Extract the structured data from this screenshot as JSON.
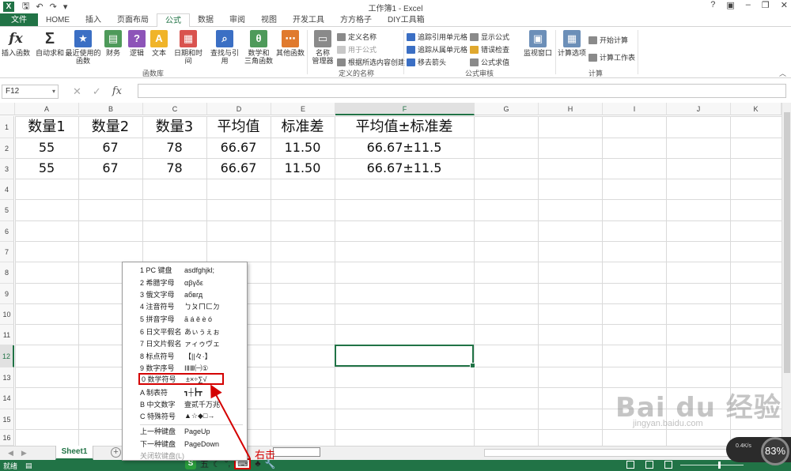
{
  "window": {
    "title": "工作簿1 - Excel",
    "help": "?",
    "min": "–",
    "restore": "❐",
    "close": "✕"
  },
  "ribbon_tabs": [
    "文件",
    "HOME",
    "插入",
    "页面布局",
    "公式",
    "数据",
    "审阅",
    "视图",
    "开发工具",
    "方方格子",
    "DIY工具箱"
  ],
  "ribbon": {
    "insert_function": "插入函数",
    "autosum": "自动求和",
    "recent": "最近使用的\n函数",
    "financial": "财务",
    "logical": "逻辑",
    "text": "文本",
    "datetime": "日期和时间",
    "lookup": "查找与引用",
    "math": "数学和\n三角函数",
    "more": "其他函数",
    "group_library": "函数库",
    "name_manager": "名称\n管理器",
    "define_name": "定义名称",
    "use_in_formula": "用于公式",
    "create_from_sel": "根据所选内容创建",
    "group_names": "定义的名称",
    "trace_prec": "追踪引用单元格",
    "trace_dep": "追踪从属单元格",
    "remove_arrows": "移去箭头",
    "show_formulas": "显示公式",
    "error_check": "错误检查",
    "eval_formula": "公式求值",
    "group_audit": "公式审核",
    "watch_window": "监视窗口",
    "calc_options": "计算选项",
    "calc_now": "开始计算",
    "calc_sheet": "计算工作表",
    "group_calc": "计算"
  },
  "formula_bar": {
    "name_box": "F12",
    "formula": ""
  },
  "columns": [
    "A",
    "B",
    "C",
    "D",
    "E",
    "F",
    "G",
    "H",
    "I",
    "J",
    "K"
  ],
  "rows": [
    "1",
    "2",
    "3",
    "4",
    "5",
    "6",
    "7",
    "8",
    "9",
    "10",
    "11",
    "12",
    "13",
    "14",
    "15",
    "16"
  ],
  "cells": {
    "header": [
      "数量1",
      "数量2",
      "数量3",
      "平均值",
      "标准差",
      "平均值±标准差"
    ],
    "row2": [
      "55",
      "67",
      "78",
      "66.67",
      "11.50",
      "66.67±11.5"
    ],
    "row3": [
      "55",
      "67",
      "78",
      "66.67",
      "11.50",
      "66.67±11.5"
    ]
  },
  "context_menu": [
    {
      "label": "1 PC 键盘",
      "sample": "asdfghjkl;"
    },
    {
      "label": "2 希腊字母",
      "sample": "αβγδε"
    },
    {
      "label": "3 俄文字母",
      "sample": "абвгд"
    },
    {
      "label": "4 注音符号",
      "sample": "ㄅㄆㄇㄈㄉ"
    },
    {
      "label": "5 拼音字母",
      "sample": "ā á ě è ó"
    },
    {
      "label": "6 日文平假名",
      "sample": "あぃぅぇぉ"
    },
    {
      "label": "7 日文片假名",
      "sample": "ァィゥヴェ"
    },
    {
      "label": "8 标点符号",
      "sample": "【||々·】"
    },
    {
      "label": "9 数字序号",
      "sample": "ⅠⅡⅢ㈠①"
    },
    {
      "label": "0 数学符号",
      "sample": "±×÷∑√"
    },
    {
      "label": "A 制表符",
      "sample": "┓┼┣┳"
    },
    {
      "label": "B 中文数字",
      "sample": "壹贰千万兆"
    },
    {
      "label": "C 特殊符号",
      "sample": "▲☆◆□→"
    },
    {
      "label": "上一种键盘",
      "sample": "PageUp"
    },
    {
      "label": "下一种键盘",
      "sample": "PageDown"
    },
    {
      "label": "关闭软键盘(L)",
      "sample": ""
    }
  ],
  "sheet_tab": "Sheet1",
  "status": {
    "ready": "就绪",
    "annotation": "右击",
    "ime_wu": "五",
    "speed": "83%",
    "rate": "0.4K/s"
  },
  "watermark": {
    "main": "Bai du 经验",
    "sub": "jingyan.baidu.com"
  },
  "colors": {
    "excel_green": "#217346",
    "highlight_red": "#d40000"
  }
}
